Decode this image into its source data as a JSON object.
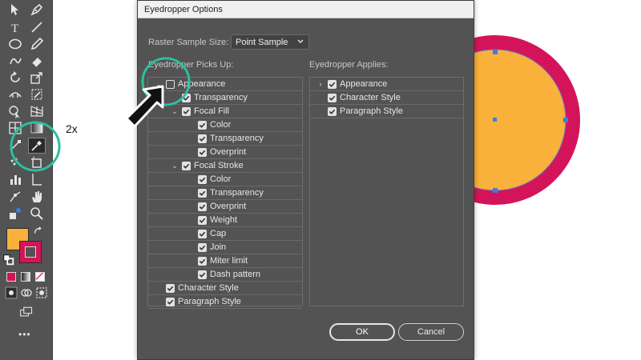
{
  "dialog": {
    "title": "Eyedropper Options",
    "raster_sample_size_label": "Raster Sample Size:",
    "raster_sample_size_value": "Point Sample",
    "picks_up_header": "Eyedropper Picks Up:",
    "applies_header": "Eyedropper Applies:",
    "picks_up_items": [
      {
        "label": "Appearance",
        "checked": false,
        "twisty": "down"
      },
      {
        "label": "Transparency",
        "checked": true,
        "twisty": ""
      },
      {
        "label": "Focal Fill",
        "checked": true,
        "twisty": "down"
      },
      {
        "label": "Color",
        "checked": true,
        "twisty": ""
      },
      {
        "label": "Transparency",
        "checked": true,
        "twisty": ""
      },
      {
        "label": "Overprint",
        "checked": true,
        "twisty": ""
      },
      {
        "label": "Focal Stroke",
        "checked": true,
        "twisty": "down"
      },
      {
        "label": "Color",
        "checked": true,
        "twisty": ""
      },
      {
        "label": "Transparency",
        "checked": true,
        "twisty": ""
      },
      {
        "label": "Overprint",
        "checked": true,
        "twisty": ""
      },
      {
        "label": "Weight",
        "checked": true,
        "twisty": ""
      },
      {
        "label": "Cap",
        "checked": true,
        "twisty": ""
      },
      {
        "label": "Join",
        "checked": true,
        "twisty": ""
      },
      {
        "label": "Miter limit",
        "checked": true,
        "twisty": ""
      },
      {
        "label": "Dash pattern",
        "checked": true,
        "twisty": ""
      },
      {
        "label": "Character Style",
        "checked": true,
        "twisty": ""
      },
      {
        "label": "Paragraph Style",
        "checked": true,
        "twisty": ""
      }
    ],
    "applies_items": [
      {
        "label": "Appearance",
        "checked": true,
        "twisty": "right"
      },
      {
        "label": "Character Style",
        "checked": true,
        "twisty": ""
      },
      {
        "label": "Paragraph Style",
        "checked": true,
        "twisty": ""
      }
    ],
    "ok_label": "OK",
    "cancel_label": "Cancel"
  },
  "annotation": {
    "zoom_label": "2x",
    "highlight_color": "#2bbf9f"
  },
  "toolbar": {
    "fill_color": "#f9b13b",
    "stroke_color": "#d4145a",
    "overflow_label": "•••"
  },
  "artwork": {
    "fill_color": "#f9b13b",
    "stroke_color": "#d4145a",
    "anchor_color": "#3f7be0"
  },
  "colors": {
    "toolbar_bg": "#535353",
    "dialog_bg": "#535353",
    "titlebar_bg": "#f0f0f0"
  }
}
